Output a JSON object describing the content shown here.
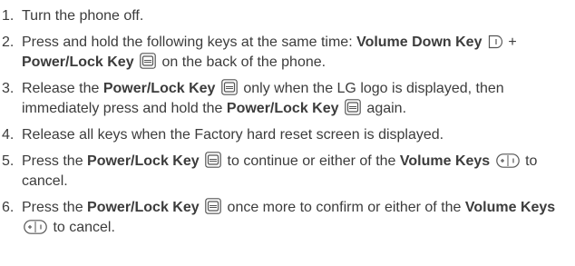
{
  "steps": [
    {
      "number": "1.",
      "parts": [
        {
          "t": "text",
          "v": "Turn the phone off."
        }
      ]
    },
    {
      "number": "2.",
      "parts": [
        {
          "t": "text",
          "v": "Press and hold the following keys at the same time: "
        },
        {
          "t": "key",
          "v": "Volume Down Key"
        },
        {
          "t": "text",
          "v": " "
        },
        {
          "t": "icon",
          "v": "volume-down-key-icon"
        },
        {
          "t": "text",
          "v": " + "
        },
        {
          "t": "key",
          "v": "Power/Lock Key"
        },
        {
          "t": "text",
          "v": " "
        },
        {
          "t": "icon",
          "v": "power-lock-key-icon"
        },
        {
          "t": "text",
          "v": " on the back of the phone."
        }
      ]
    },
    {
      "number": "3.",
      "parts": [
        {
          "t": "text",
          "v": "Release the "
        },
        {
          "t": "key",
          "v": "Power/Lock Key"
        },
        {
          "t": "text",
          "v": " "
        },
        {
          "t": "icon",
          "v": "power-lock-key-icon"
        },
        {
          "t": "text",
          "v": " only when the LG logo is displayed, then immediately press and hold the "
        },
        {
          "t": "key",
          "v": "Power/Lock Key"
        },
        {
          "t": "text",
          "v": " "
        },
        {
          "t": "icon",
          "v": "power-lock-key-icon"
        },
        {
          "t": "text",
          "v": " again."
        }
      ]
    },
    {
      "number": "4.",
      "parts": [
        {
          "t": "text",
          "v": "Release all keys when the Factory hard reset screen is displayed."
        }
      ]
    },
    {
      "number": "5.",
      "parts": [
        {
          "t": "text",
          "v": "Press the "
        },
        {
          "t": "key",
          "v": "Power/Lock Key"
        },
        {
          "t": "text",
          "v": " "
        },
        {
          "t": "icon",
          "v": "power-lock-key-icon"
        },
        {
          "t": "text",
          "v": " to continue or either of the "
        },
        {
          "t": "key",
          "v": "Volume Keys"
        },
        {
          "t": "text",
          "v": " "
        },
        {
          "t": "icon",
          "v": "volume-keys-icon"
        },
        {
          "t": "text",
          "v": " to cancel."
        }
      ]
    },
    {
      "number": "6.",
      "parts": [
        {
          "t": "text",
          "v": "Press the "
        },
        {
          "t": "key",
          "v": "Power/Lock Key"
        },
        {
          "t": "text",
          "v": " "
        },
        {
          "t": "icon",
          "v": "power-lock-key-icon"
        },
        {
          "t": "text",
          "v": " once more to confirm or either of the "
        },
        {
          "t": "key",
          "v": "Volume Keys"
        },
        {
          "t": "text",
          "v": " "
        },
        {
          "t": "icon",
          "v": "volume-keys-icon"
        },
        {
          "t": "text",
          "v": " to cancel."
        }
      ]
    }
  ],
  "colors": {
    "text": "#3c3c3c",
    "key_text": "#2a2a2a",
    "icon_stroke": "#555555",
    "icon_fill": "#ffffff"
  }
}
